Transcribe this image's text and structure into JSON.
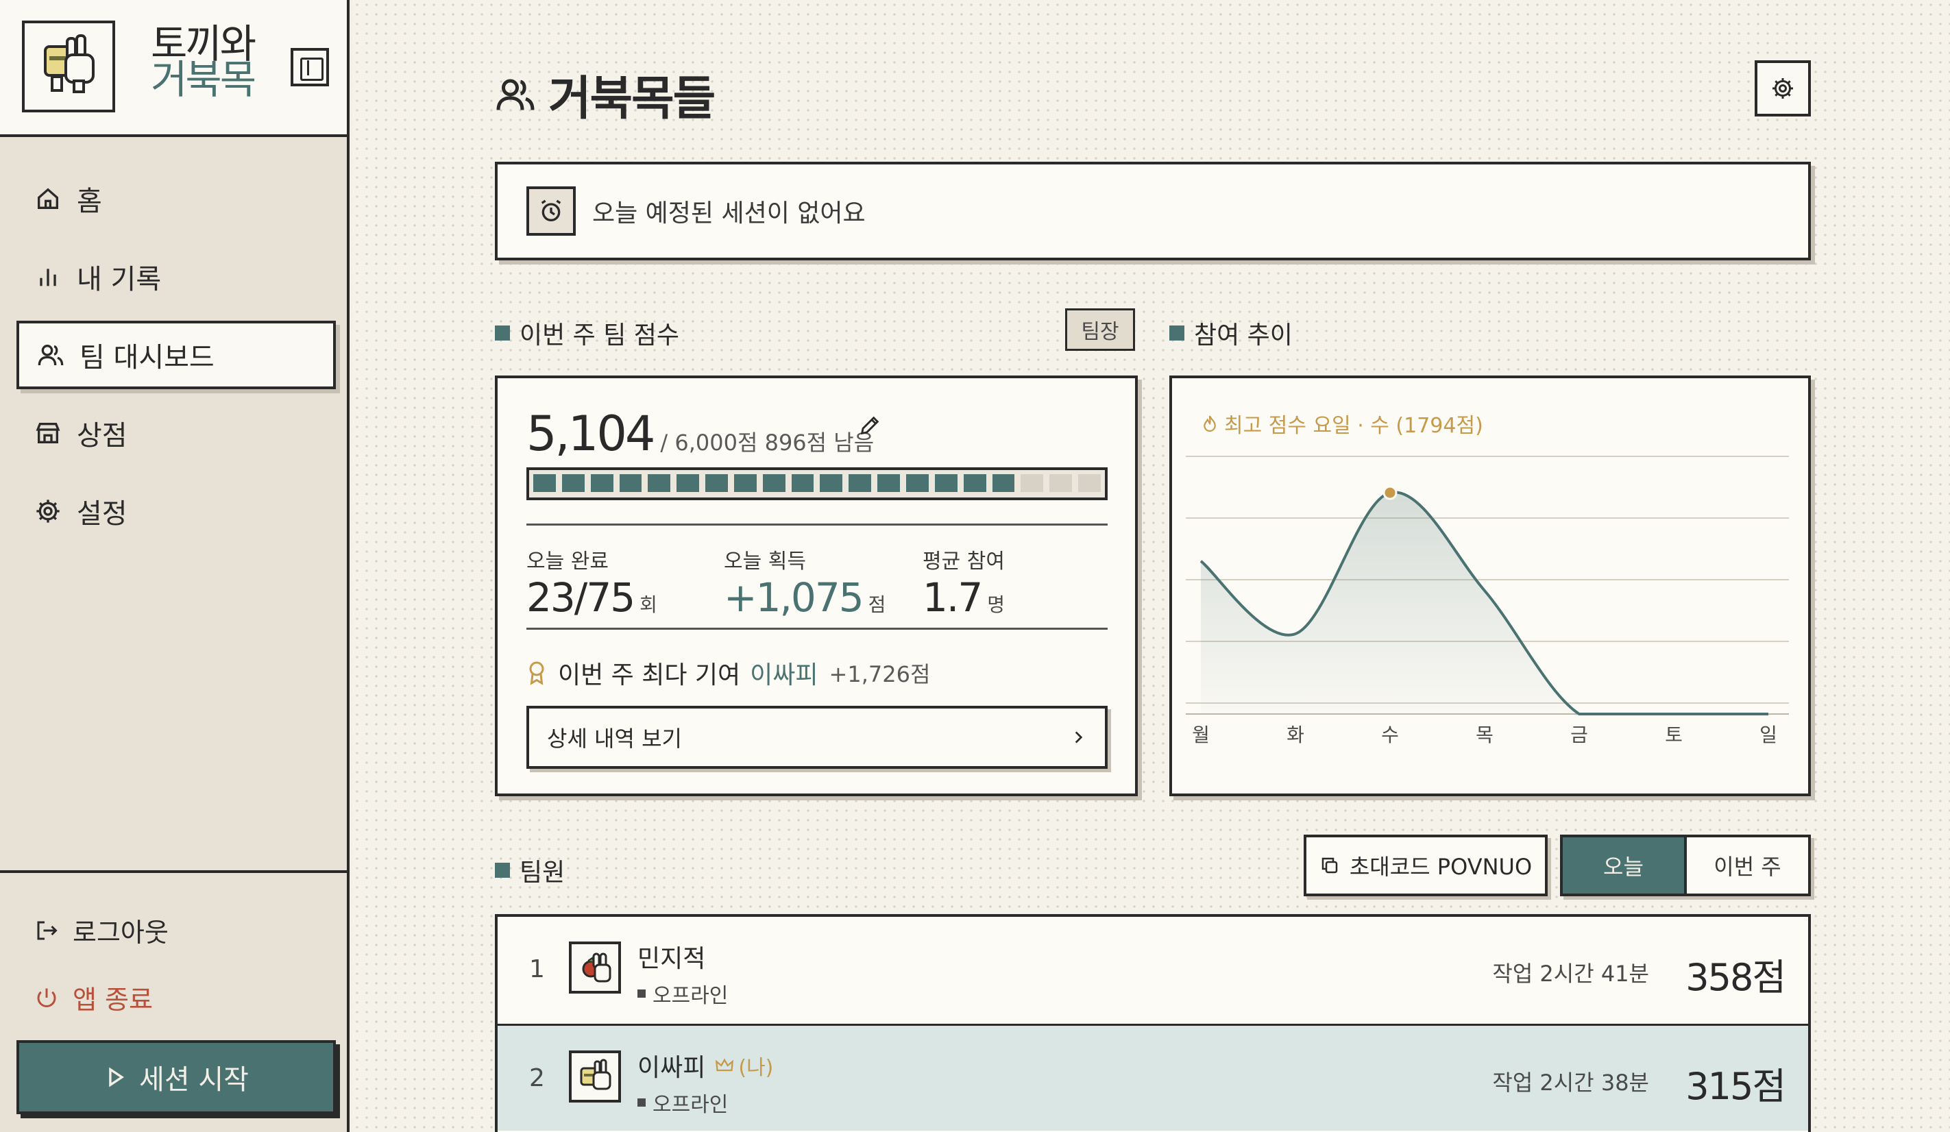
{
  "brand": {
    "line1": "토끼와",
    "line2": "거북목"
  },
  "nav": [
    {
      "label": "홈",
      "icon": "home-icon",
      "active": false
    },
    {
      "label": "내 기록",
      "icon": "bar-chart-icon",
      "active": false
    },
    {
      "label": "팀 대시보드",
      "icon": "users-icon",
      "active": true
    },
    {
      "label": "상점",
      "icon": "store-icon",
      "active": false
    },
    {
      "label": "설정",
      "icon": "gear-icon",
      "active": false
    }
  ],
  "sidebar_bottom": {
    "logout": "로그아웃",
    "quit": "앱 종료",
    "start": "세션 시작"
  },
  "page": {
    "title": "거북목들"
  },
  "notice": {
    "text": "오늘 예정된 세션이 없어요"
  },
  "score_section": {
    "label": "이번 주 팀 점수",
    "leader_badge": "팀장",
    "score": "5,104",
    "goal_text": "/ 6,000점  896점 남음",
    "progress": {
      "filled": 17,
      "total": 20
    },
    "stats": [
      {
        "label": "오늘 완료",
        "value": "23/75",
        "unit": "회",
        "accent": false
      },
      {
        "label": "오늘 획득",
        "value": "+1,075",
        "unit": "점",
        "accent": true
      },
      {
        "label": "평균 참여",
        "value": "1.7",
        "unit": "명",
        "accent": false
      }
    ],
    "top_contributor": {
      "prefix": "이번 주 최다 기여",
      "name": "이싸피",
      "points": "+1,726점"
    },
    "detail_button": "상세 내역 보기"
  },
  "trend_section": {
    "label": "참여 추이",
    "note": "최고 점수 요일 · 수 (1794점)"
  },
  "chart_data": {
    "type": "area",
    "categories": [
      "월",
      "화",
      "수",
      "목",
      "금",
      "토",
      "일"
    ],
    "values": [
      1240,
      650,
      1794,
      1000,
      0,
      0,
      0
    ],
    "ylim": [
      0,
      2000
    ],
    "grid": true,
    "highlight": {
      "category": "수",
      "value": 1794
    },
    "colors": {
      "line": "#4a7270",
      "highlight": "#c79a4a"
    }
  },
  "members_section": {
    "label": "팀원",
    "invite_button": "초대코드 POVNUO",
    "toggle": {
      "today": "오늘",
      "week": "이번 주"
    },
    "rows": [
      {
        "rank": "1",
        "name": "민지적",
        "me_tag": "",
        "status": "오프라인",
        "work": "작업 2시간 41분",
        "score": "358점",
        "is_me": false
      },
      {
        "rank": "2",
        "name": "이싸피",
        "me_tag": "(나)",
        "status": "오프라인",
        "work": "작업 2시간 38분",
        "score": "315점",
        "is_me": true
      }
    ]
  },
  "colors": {
    "accent": "#4a7270",
    "gold": "#c79a4a",
    "background": "#f5f2ea",
    "sidebar": "#e7e1d6"
  }
}
